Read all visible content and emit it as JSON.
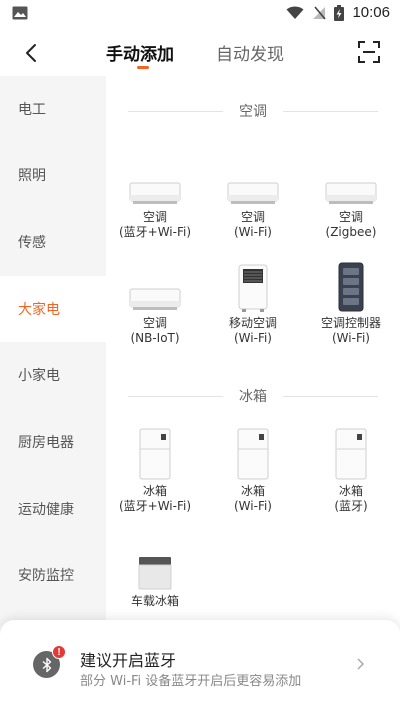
{
  "status_bar": {
    "time": "10:06"
  },
  "header": {
    "tabs": [
      {
        "label": "手动添加",
        "active": true
      },
      {
        "label": "自动发现",
        "active": false
      }
    ]
  },
  "sidebar": {
    "items": [
      {
        "label": "电工"
      },
      {
        "label": "照明"
      },
      {
        "label": "传感"
      },
      {
        "label": "大家电",
        "active": true
      },
      {
        "label": "小家电"
      },
      {
        "label": "厨房电器"
      },
      {
        "label": "运动健康"
      },
      {
        "label": "安防监控"
      }
    ]
  },
  "sections": [
    {
      "title": "空调",
      "devices": [
        {
          "name": "空调",
          "sub": "(蓝牙+Wi-Fi)",
          "icon": "wall-ac-icon"
        },
        {
          "name": "空调",
          "sub": "(Wi-Fi)",
          "icon": "wall-ac-icon"
        },
        {
          "name": "空调",
          "sub": "(Zigbee)",
          "icon": "wall-ac-icon"
        },
        {
          "name": "空调",
          "sub": "(NB-IoT)",
          "icon": "wall-ac-icon"
        },
        {
          "name": "移动空调",
          "sub": "(Wi-Fi)",
          "icon": "portable-ac-icon"
        },
        {
          "name": "空调控制器",
          "sub": "(Wi-Fi)",
          "icon": "ac-controller-icon"
        }
      ]
    },
    {
      "title": "冰箱",
      "devices": [
        {
          "name": "冰箱",
          "sub": "(蓝牙+Wi-Fi)",
          "icon": "fridge-icon"
        },
        {
          "name": "冰箱",
          "sub": "(Wi-Fi)",
          "icon": "fridge-icon"
        },
        {
          "name": "冰箱",
          "sub": "(蓝牙)",
          "icon": "fridge-icon"
        },
        {
          "name": "车载冰箱",
          "sub": "",
          "icon": "car-fridge-icon"
        }
      ]
    }
  ],
  "bottom_sheet": {
    "title": "建议开启蓝牙",
    "subtitle": "部分 Wi-Fi 设备蓝牙开启后更容易添加"
  },
  "colors": {
    "accent": "#f26522",
    "warning": "#e53935"
  }
}
